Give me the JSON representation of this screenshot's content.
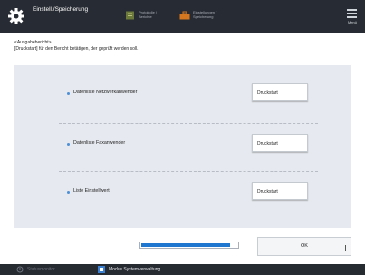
{
  "header": {
    "title": "Einstell./Speicherung",
    "tabs": [
      {
        "label": "Protokolle / Berichte",
        "icon": "document-icon",
        "color": "#6b7a3a"
      },
      {
        "label": "Einstellungen / Speicherung",
        "icon": "toolbox-icon",
        "color": "#d4771f"
      }
    ],
    "menu_label": "Menü"
  },
  "description": {
    "line1": "<Ausgabebericht>",
    "line2": "[Druckstart] für den Bericht betätigen, der geprüft werden soll."
  },
  "reports": [
    {
      "label": "Datenliste Netzwerkanwender",
      "button": "Druckstart"
    },
    {
      "label": "Datenliste Faxanwender",
      "button": "Druckstart"
    },
    {
      "label": "Liste Einstellwert",
      "button": "Druckstart"
    }
  ],
  "progress": {
    "fraction": 0.92
  },
  "ok_label": "OK",
  "status": {
    "left_label": "Statusmonitor",
    "right_label": "Modus Systemverwaltung"
  },
  "colors": {
    "topbar": "#272b33",
    "panel": "#e6e9ef",
    "accent": "#1f77d0",
    "bullet": "#4d8fd6"
  }
}
